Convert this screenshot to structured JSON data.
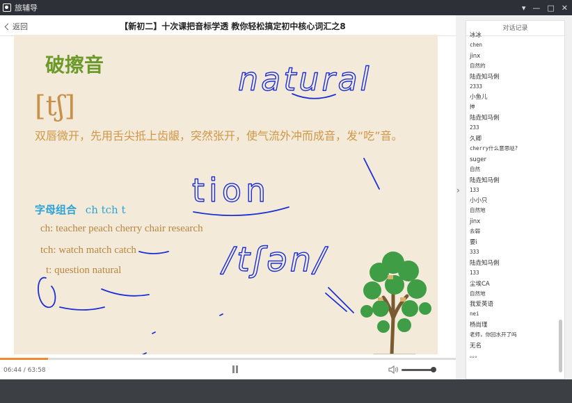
{
  "app": {
    "title": "旅辅导",
    "controls": [
      "▾",
      "—",
      "□",
      "✕"
    ]
  },
  "nav": {
    "back_label": "返回",
    "course_title": "【新初二】十次课把音标学透 教你轻松搞定初中核心词汇之8"
  },
  "slide": {
    "heading": "破擦音",
    "phonetic": "[tʃ]",
    "description": "双唇微开，先用舌尖抵上齿龈，突然张开，使气流外冲而成音，发“吃”音。",
    "combo_label": "字母组合",
    "combo_letters": "ch  tch  t",
    "line1": "ch:  teacher   peach   cherry  chair  research",
    "line2": "tch:  watch   match  catch",
    "line3": "t:  question  natural",
    "handwriting": [
      "natural",
      "tion",
      "/tʃən/"
    ]
  },
  "player": {
    "current_time": "06:44",
    "total_time": "63:58",
    "progress": 0.105,
    "volume": 0.9
  },
  "chat": {
    "title": "对话记录",
    "messages": [
      {
        "user": "冰冰",
        "text": "chen"
      },
      {
        "user": "jinx",
        "text": "自然的"
      },
      {
        "user": "陆垚知马俐",
        "text": "2333"
      },
      {
        "user": "小鱼儿",
        "text": "抻"
      },
      {
        "user": "陆垚知马俐",
        "text": "233"
      },
      {
        "user": "久卿",
        "text": "cherry什么意思哒?"
      },
      {
        "user": "suger",
        "text": "自然"
      },
      {
        "user": "陆垚知马俐",
        "text": "133"
      },
      {
        "user": "小小只",
        "text": "自然地"
      },
      {
        "user": "jinx",
        "text": "去弱"
      },
      {
        "user": "要i",
        "text": "333"
      },
      {
        "user": "陆垚知马俐",
        "text": "133"
      },
      {
        "user": "尘埃CA",
        "text": "自然地"
      },
      {
        "user": "我爱英语",
        "text": "nei"
      },
      {
        "user": "杨尚瑾",
        "text": "老师，你回水开了吗"
      },
      {
        "user": "无名",
        "text": "。。。"
      }
    ]
  },
  "colors": {
    "accent": "#f08a2e",
    "ink": "#1b2fd6",
    "heading": "#6b9a2a",
    "combo": "#2ba3d8"
  }
}
